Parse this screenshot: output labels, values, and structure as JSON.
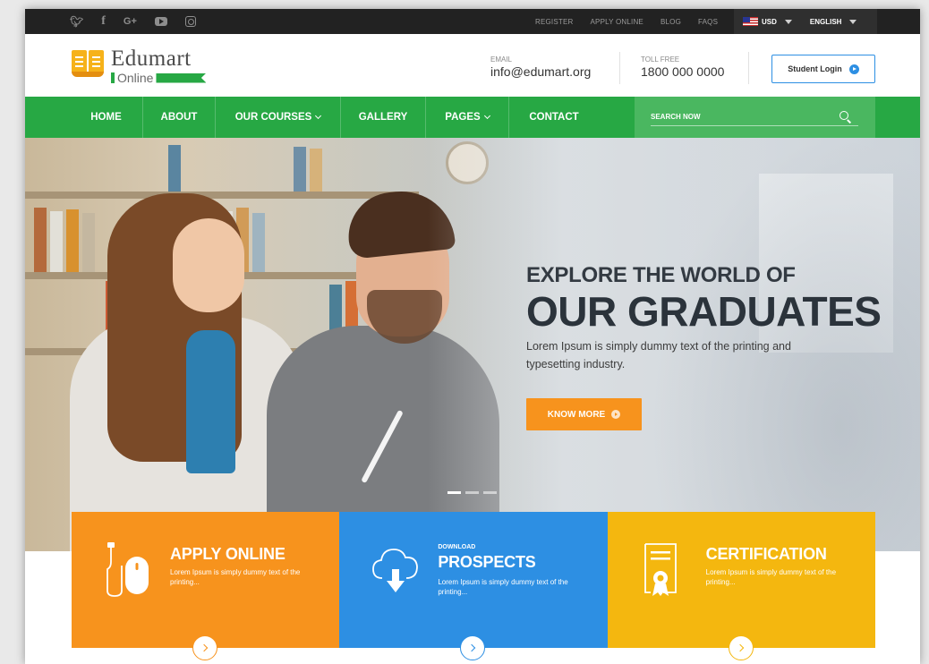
{
  "topbar": {
    "social": [
      {
        "icon": "twitter-icon",
        "glyph": "❖"
      },
      {
        "icon": "facebook-icon",
        "glyph": "f"
      },
      {
        "icon": "google-plus-icon",
        "glyph": "G+"
      },
      {
        "icon": "youtube-icon"
      },
      {
        "icon": "instagram-icon"
      }
    ],
    "links": [
      "REGISTER",
      "APPLY ONLINE",
      "BLOG",
      "FAQS"
    ],
    "currency": "USD",
    "language": "ENGLISH"
  },
  "header": {
    "brand": "Edumart",
    "brand_sub": "Online",
    "email_label": "EMAIL",
    "email_value": "info@edumart.org",
    "phone_label": "TOLL FREE",
    "phone_value": "1800 000 0000",
    "login_label": "Student Login"
  },
  "nav": {
    "items": [
      {
        "label": "HOME",
        "dropdown": false
      },
      {
        "label": "ABOUT",
        "dropdown": false
      },
      {
        "label": "OUR COURSES",
        "dropdown": true
      },
      {
        "label": "GALLERY",
        "dropdown": false
      },
      {
        "label": "PAGES",
        "dropdown": true
      },
      {
        "label": "CONTACT",
        "dropdown": false
      }
    ],
    "search_placeholder": "SEARCH NOW"
  },
  "hero": {
    "kicker": "EXPLORE THE WORLD OF",
    "title": "OUR GRADUATES",
    "description": "Lorem Ipsum is simply dummy text of the printing and typesetting industry.",
    "cta_label": "KNOW MORE",
    "slides": 3,
    "active_slide": 1
  },
  "features": [
    {
      "kicker": "",
      "title": "APPLY ONLINE",
      "description": "Lorem Ipsum is simply dummy text of the printing...",
      "icon": "mouse-icon",
      "color": "#f7931d"
    },
    {
      "kicker": "DOWNLOAD",
      "title": "PROSPECTS",
      "description": "Lorem Ipsum is simply dummy text of the printing...",
      "icon": "cloud-download-icon",
      "color": "#2d8fe3"
    },
    {
      "kicker": "",
      "title": "CERTIFICATION",
      "description": "Lorem Ipsum is simply dummy text of the printing...",
      "icon": "certificate-icon",
      "color": "#f4b70f"
    }
  ],
  "colors": {
    "topbar": "#222222",
    "nav": "#27a844",
    "accent_orange": "#f7931d",
    "accent_blue": "#2d8fe3",
    "accent_yellow": "#f4b70f"
  }
}
